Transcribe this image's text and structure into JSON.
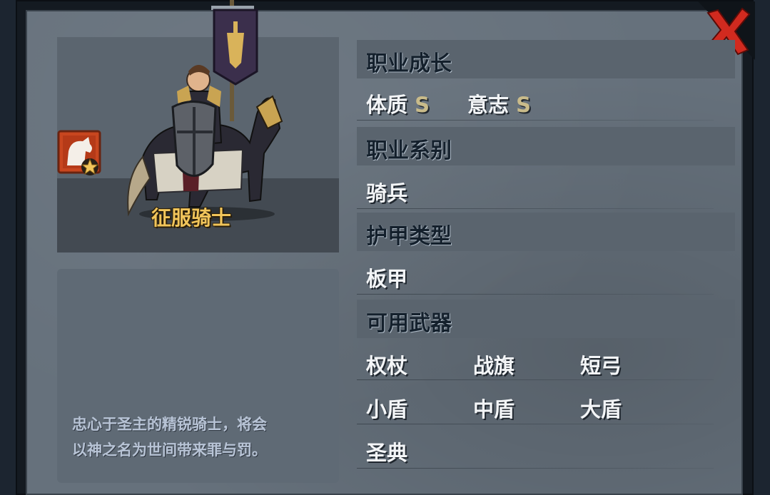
{
  "portrait": {
    "unit_name": "征服骑士"
  },
  "description": {
    "line1": "忠心于圣主的精锐骑士，将会",
    "line2": "以神之名为世间带来罪与罚。"
  },
  "sections": {
    "growth": {
      "title": "职业成长",
      "constitution_label": "体质",
      "constitution_grade": "S",
      "will_label": "意志",
      "will_grade": "S"
    },
    "class_type": {
      "title": "职业系别",
      "value": "骑兵"
    },
    "armor": {
      "title": "护甲类型",
      "value": "板甲"
    },
    "weapons": {
      "title": "可用武器",
      "items": [
        "权杖",
        "战旗",
        "短弓",
        "小盾",
        "中盾",
        "大盾",
        "圣典"
      ]
    }
  },
  "colors": {
    "accent_gold": "#f1c55b",
    "grade": "#c9bb8a",
    "close_red": "#d12a1f"
  },
  "icons": {
    "close": "close-x-icon",
    "class_icon": "horse-class-icon",
    "star": "star-icon",
    "banner": "banner-icon"
  }
}
